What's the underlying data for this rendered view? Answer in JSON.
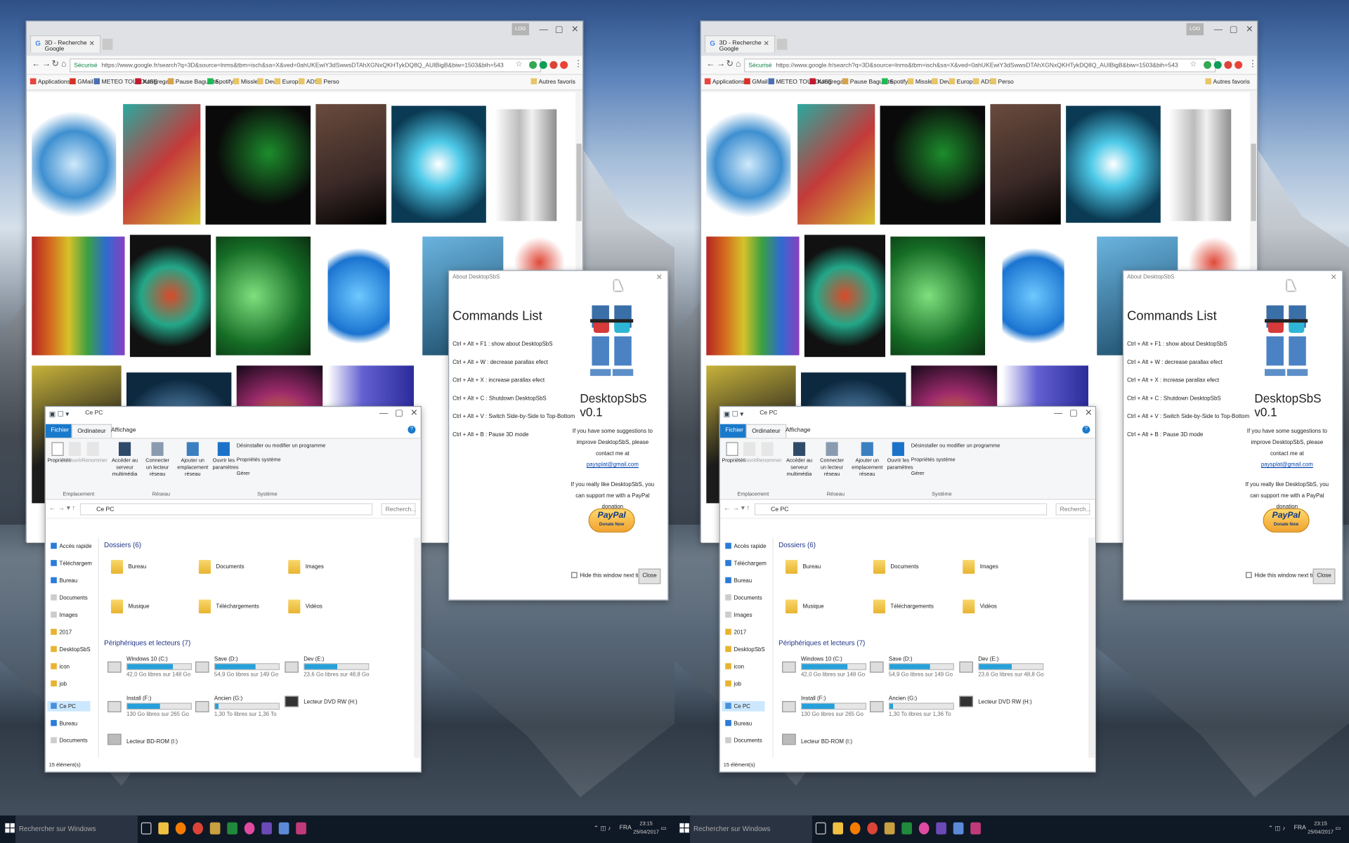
{
  "browser": {
    "tab_title": "3D - Recherche Google",
    "user_label": "LOG",
    "secure_label": "Sécurisé",
    "url": "https://www.google.fr/search?q=3D&source=lnms&tbm=isch&sa=X&ved=0ahUKEwiY3dSwwsDTAhXGNxQKHTykDQ8Q_AUIBigB&biw=1503&bih=543",
    "bookmarks": [
      "Applications",
      "GMail",
      "METEO TOULOUSE",
      "Kongregate",
      "Pause Baguette",
      "Spotify",
      "Missler",
      "Dev",
      "Europe",
      "ADS",
      "Perso"
    ],
    "other_bookmarks": "Autres favoris"
  },
  "explorer": {
    "title": "Ce PC",
    "tabs": [
      "Fichier",
      "Ordinateur",
      "Affichage"
    ],
    "ribbon": {
      "properties": "Propriétés",
      "open": "Ouvrir",
      "rename": "Renommer",
      "media": "Accéder au serveur multimédia",
      "connect": "Connecter un lecteur réseau",
      "add_location": "Ajouter un emplacement réseau",
      "open_settings": "Ouvrir les paramètres",
      "uninstall": "Désinstaller ou modifier un programme",
      "sys_props": "Propriétés système",
      "manage": "Gérer",
      "group_location": "Emplacement",
      "group_network": "Réseau",
      "group_system": "Système"
    },
    "path": "Ce PC",
    "search_placeholder": "Recherch...",
    "nav": [
      "Accès rapide",
      "Téléchargem",
      "Bureau",
      "Documents",
      "Images",
      "2017",
      "DesktopSbS",
      "icon",
      "job",
      "Ce PC",
      "Bureau",
      "Documents"
    ],
    "folders_header": "Dossiers (6)",
    "folders": [
      "Bureau",
      "Documents",
      "Images",
      "Musique",
      "Téléchargements",
      "Vidéos"
    ],
    "devices_header": "Périphériques et lecteurs (7)",
    "drives": [
      {
        "name": "Windows 10 (C:)",
        "free": "42,0 Go libres sur 148 Go",
        "used": 0.72
      },
      {
        "name": "Save (D:)",
        "free": "54,9 Go libres sur 149 Go",
        "used": 0.63
      },
      {
        "name": "Dev (E:)",
        "free": "23,6 Go libres sur 48,8 Go",
        "used": 0.52
      },
      {
        "name": "Install (F:)",
        "free": "130 Go libres sur 265 Go",
        "used": 0.51
      },
      {
        "name": "Ancien (G:)",
        "free": "1,30 To libres sur 1,36 To",
        "used": 0.05
      }
    ],
    "dvd": "Lecteur DVD RW (H:)",
    "bd": "Lecteur BD-ROM (I:)",
    "status": "15 élément(s)"
  },
  "about": {
    "title": "About DesktopSbS",
    "heading": "Commands List",
    "commands": [
      "Ctrl + Alt + F1 : show about DesktopSbS",
      "Ctrl + Alt + W : decrease parallax efect",
      "Ctrl + Alt + X : increase parallax efect",
      "Ctrl + Alt + C : Shutdown DesktopSbS",
      "Ctrl + Alt + V : Switch Side-by-Side to Top-Bottom",
      "Ctrl + Alt + B : Pause 3D mode"
    ],
    "version": "DesktopSbS v0.1",
    "suggest": "If you have some suggestions to improve DesktopSbS, please contact me at",
    "email": "paysplat@gmail.com",
    "donate": "If you really like DesktopSbS, you can support me with a PayPal donation",
    "paypal": "PayPal",
    "paypal_sub": "Donate Now",
    "hide": "Hide this window next time",
    "close": "Close"
  },
  "taskbar": {
    "search": "Rechercher sur Windows",
    "lang": "FRA",
    "time": "23:15",
    "date": "25/04/2017"
  }
}
